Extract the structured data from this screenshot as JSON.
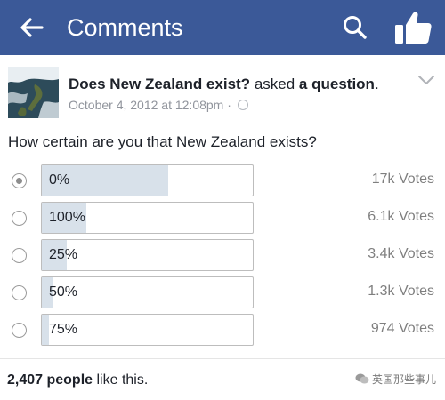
{
  "header": {
    "title": "Comments",
    "bg_color": "#3b5998",
    "icons": [
      "back-arrow-icon",
      "search-icon",
      "thumbs-up-icon"
    ]
  },
  "post": {
    "page_name": "Does New Zealand exist?",
    "action_text": "asked",
    "object_text": "a question",
    "period": ".",
    "timestamp": "October 4, 2012 at 12:08pm",
    "separator": "·"
  },
  "poll": {
    "question": "How certain are you that New Zealand exists?",
    "options": [
      {
        "label": "0%",
        "votes": "17k Votes",
        "share": 0.6,
        "checked": true
      },
      {
        "label": "100%",
        "votes": "6.1k Votes",
        "share": 0.21,
        "checked": false
      },
      {
        "label": "25%",
        "votes": "3.4k Votes",
        "share": 0.12,
        "checked": false
      },
      {
        "label": "50%",
        "votes": "1.3k Votes",
        "share": 0.05,
        "checked": false
      },
      {
        "label": "75%",
        "votes": "974 Votes",
        "share": 0.035,
        "checked": false
      }
    ]
  },
  "footer": {
    "like_count": "2,407 people",
    "like_suffix": " like this."
  },
  "watermark": {
    "text": "英国那些事儿"
  }
}
